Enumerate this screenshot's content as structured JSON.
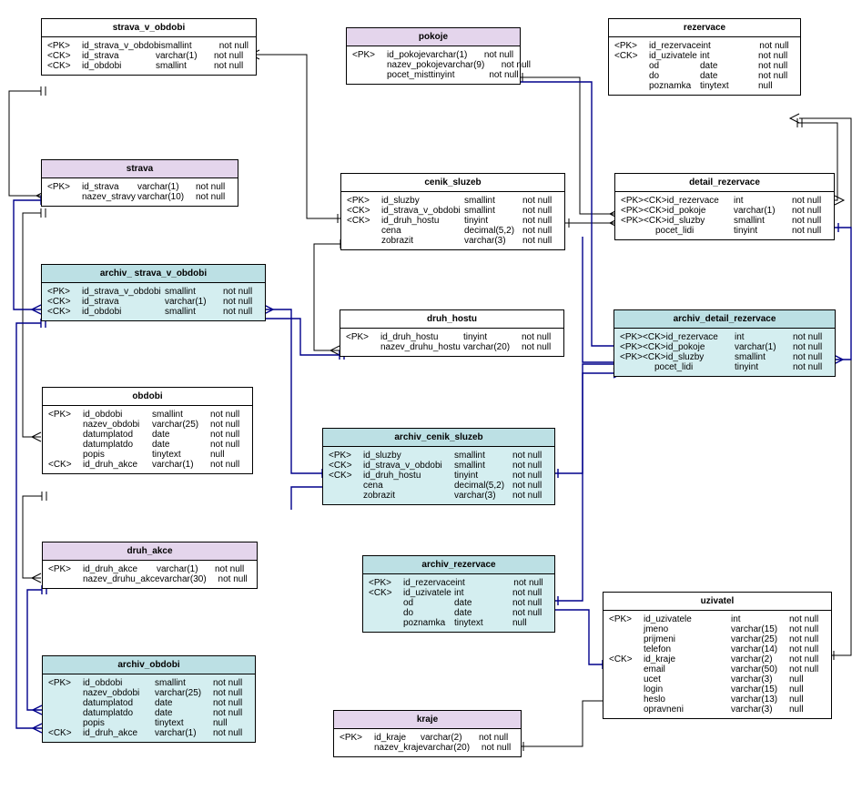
{
  "entities": {
    "strava_v_obdobi": {
      "title": "strava_v_obdobi",
      "cols": [
        {
          "k": "<PK>",
          "n": "id_strava_v_obdobi",
          "t": "smallint",
          "nn": "not null"
        },
        {
          "k": "<CK>",
          "n": "id_strava",
          "t": "varchar(1)",
          "nn": "not null"
        },
        {
          "k": "<CK>",
          "n": "id_obdobi",
          "t": "smallint",
          "nn": "not null"
        }
      ]
    },
    "pokoje": {
      "title": "pokoje",
      "cols": [
        {
          "k": "<PK>",
          "n": "id_pokoje",
          "t": "varchar(1)",
          "nn": "not null"
        },
        {
          "k": "",
          "n": "nazev_pokoje",
          "t": "varchar(9)",
          "nn": "not null"
        },
        {
          "k": "",
          "n": "pocet_mist",
          "t": "tinyint",
          "nn": "not null"
        }
      ]
    },
    "rezervace": {
      "title": "rezervace",
      "cols": [
        {
          "k": "<PK>",
          "n": "id_rezervace",
          "t": "int",
          "nn": "not null"
        },
        {
          "k": "<CK>",
          "n": "id_uzivatele",
          "t": "int",
          "nn": "not null"
        },
        {
          "k": "",
          "n": "od",
          "t": "date",
          "nn": "not null"
        },
        {
          "k": "",
          "n": "do",
          "t": "date",
          "nn": "not null"
        },
        {
          "k": "",
          "n": "poznamka",
          "t": "tinytext",
          "nn": "null"
        }
      ]
    },
    "strava": {
      "title": "strava",
      "cols": [
        {
          "k": "<PK>",
          "n": "id_strava",
          "t": "varchar(1)",
          "nn": "not null"
        },
        {
          "k": "",
          "n": "nazev_stravy",
          "t": "varchar(10)",
          "nn": "not null"
        }
      ]
    },
    "cenik_sluzeb": {
      "title": "cenik_sluzeb",
      "cols": [
        {
          "k": "<PK>",
          "n": "id_sluzby",
          "t": "smallint",
          "nn": "not null"
        },
        {
          "k": "<CK>",
          "n": "id_strava_v_obdobi",
          "t": "smallint",
          "nn": "not null"
        },
        {
          "k": "<CK>",
          "n": "id_druh_hostu",
          "t": "tinyint",
          "nn": "not null"
        },
        {
          "k": "",
          "n": "cena",
          "t": "decimal(5,2)",
          "nn": "not null"
        },
        {
          "k": "",
          "n": "zobrazit",
          "t": "varchar(3)",
          "nn": "not null"
        }
      ]
    },
    "detail_rezervace": {
      "title": "detail_rezervace",
      "cols": [
        {
          "k": "<PK><CK>",
          "n": "id_rezervace",
          "t": "int",
          "nn": "not null"
        },
        {
          "k": "<PK><CK>",
          "n": "id_pokoje",
          "t": "varchar(1)",
          "nn": "not null"
        },
        {
          "k": "<PK><CK>",
          "n": "id_sluzby",
          "t": "smallint",
          "nn": "not null"
        },
        {
          "k": "",
          "n": "pocet_lidi",
          "t": "tinyint",
          "nn": "not null"
        }
      ]
    },
    "archiv_strava_v_obdobi": {
      "title": "archiv_ strava_v_obdobi",
      "cols": [
        {
          "k": "<PK>",
          "n": "id_strava_v_obdobi",
          "t": "smallint",
          "nn": "not null"
        },
        {
          "k": "<CK>",
          "n": "id_strava",
          "t": "varchar(1)",
          "nn": "not null"
        },
        {
          "k": "<CK>",
          "n": "id_obdobi",
          "t": "smallint",
          "nn": "not null"
        }
      ]
    },
    "druh_hostu": {
      "title": "druh_hostu",
      "cols": [
        {
          "k": "<PK>",
          "n": "id_druh_hostu",
          "t": "tinyint",
          "nn": "not null"
        },
        {
          "k": "",
          "n": "nazev_druhu_hostu",
          "t": "varchar(20)",
          "nn": "not null"
        }
      ]
    },
    "archiv_detail_rezervace": {
      "title": "archiv_detail_rezervace",
      "cols": [
        {
          "k": "<PK><CK>",
          "n": "id_rezervace",
          "t": "int",
          "nn": "not null"
        },
        {
          "k": "<PK><CK>",
          "n": "id_pokoje",
          "t": "varchar(1)",
          "nn": "not null"
        },
        {
          "k": "<PK><CK>",
          "n": "id_sluzby",
          "t": "smallint",
          "nn": "not null"
        },
        {
          "k": "",
          "n": "pocet_lidi",
          "t": "tinyint",
          "nn": "not null"
        }
      ]
    },
    "obdobi": {
      "title": "obdobi",
      "cols": [
        {
          "k": "<PK>",
          "n": "id_obdobi",
          "t": "smallint",
          "nn": "not null"
        },
        {
          "k": "",
          "n": "nazev_obdobi",
          "t": "varchar(25)",
          "nn": "not null"
        },
        {
          "k": "",
          "n": "datumplatod",
          "t": "date",
          "nn": "not null"
        },
        {
          "k": "",
          "n": "datumplatdo",
          "t": "date",
          "nn": "not null"
        },
        {
          "k": "",
          "n": "popis",
          "t": "tinytext",
          "nn": "null"
        },
        {
          "k": "<CK>",
          "n": "id_druh_akce",
          "t": "varchar(1)",
          "nn": "not null"
        }
      ]
    },
    "archiv_cenik_sluzeb": {
      "title": "archiv_cenik_sluzeb",
      "cols": [
        {
          "k": "<PK>",
          "n": "id_sluzby",
          "t": "smallint",
          "nn": "not null"
        },
        {
          "k": "<CK>",
          "n": "id_strava_v_obdobi",
          "t": "smallint",
          "nn": "not null"
        },
        {
          "k": "<CK>",
          "n": "id_druh_hostu",
          "t": "tinyint",
          "nn": "not null"
        },
        {
          "k": "",
          "n": "cena",
          "t": "decimal(5,2)",
          "nn": "not null"
        },
        {
          "k": "",
          "n": "zobrazit",
          "t": "varchar(3)",
          "nn": "not null"
        }
      ]
    },
    "druh_akce": {
      "title": "druh_akce",
      "cols": [
        {
          "k": "<PK>",
          "n": "id_druh_akce",
          "t": "varchar(1)",
          "nn": "not null"
        },
        {
          "k": "",
          "n": "nazev_druhu_akce",
          "t": "varchar(30)",
          "nn": "not null"
        }
      ]
    },
    "archiv_rezervace": {
      "title": "archiv_rezervace",
      "cols": [
        {
          "k": "<PK>",
          "n": "id_rezervace",
          "t": "int",
          "nn": "not null"
        },
        {
          "k": "<CK>",
          "n": "id_uzivatele",
          "t": "int",
          "nn": "not null"
        },
        {
          "k": "",
          "n": "od",
          "t": "date",
          "nn": "not null"
        },
        {
          "k": "",
          "n": "do",
          "t": "date",
          "nn": "not null"
        },
        {
          "k": "",
          "n": "poznamka",
          "t": "tinytext",
          "nn": "null"
        }
      ]
    },
    "uzivatel": {
      "title": "uzivatel",
      "cols": [
        {
          "k": "<PK>",
          "n": "id_uzivatele",
          "t": "int",
          "nn": "not null"
        },
        {
          "k": "",
          "n": "jmeno",
          "t": "varchar(15)",
          "nn": "not null"
        },
        {
          "k": "",
          "n": "prijmeni",
          "t": "varchar(25)",
          "nn": "not null"
        },
        {
          "k": "",
          "n": "telefon",
          "t": "varchar(14)",
          "nn": "not null"
        },
        {
          "k": "<CK>",
          "n": "id_kraje",
          "t": "varchar(2)",
          "nn": "not null"
        },
        {
          "k": "",
          "n": "email",
          "t": "varchar(50)",
          "nn": "not null"
        },
        {
          "k": "",
          "n": "ucet",
          "t": "varchar(3)",
          "nn": "null"
        },
        {
          "k": "",
          "n": "login",
          "t": "varchar(15)",
          "nn": "null"
        },
        {
          "k": "",
          "n": "heslo",
          "t": "varchar(13)",
          "nn": "null"
        },
        {
          "k": "",
          "n": "opravneni",
          "t": "varchar(3)",
          "nn": "null"
        }
      ]
    },
    "archiv_obdobi": {
      "title": "archiv_obdobi",
      "cols": [
        {
          "k": "<PK>",
          "n": "id_obdobi",
          "t": "smallint",
          "nn": "not null"
        },
        {
          "k": "",
          "n": "nazev_obdobi",
          "t": "varchar(25)",
          "nn": "not null"
        },
        {
          "k": "",
          "n": "datumplatod",
          "t": "date",
          "nn": "not null"
        },
        {
          "k": "",
          "n": "datumplatdo",
          "t": "date",
          "nn": "not null"
        },
        {
          "k": "",
          "n": "popis",
          "t": "tinytext",
          "nn": "null"
        },
        {
          "k": "<CK>",
          "n": "id_druh_akce",
          "t": "varchar(1)",
          "nn": "not null"
        }
      ]
    },
    "kraje": {
      "title": "kraje",
      "cols": [
        {
          "k": "<PK>",
          "n": "id_kraje",
          "t": "varchar(2)",
          "nn": "not null"
        },
        {
          "k": "",
          "n": "nazev_kraje",
          "t": "varchar(20)",
          "nn": "not null"
        }
      ]
    }
  }
}
